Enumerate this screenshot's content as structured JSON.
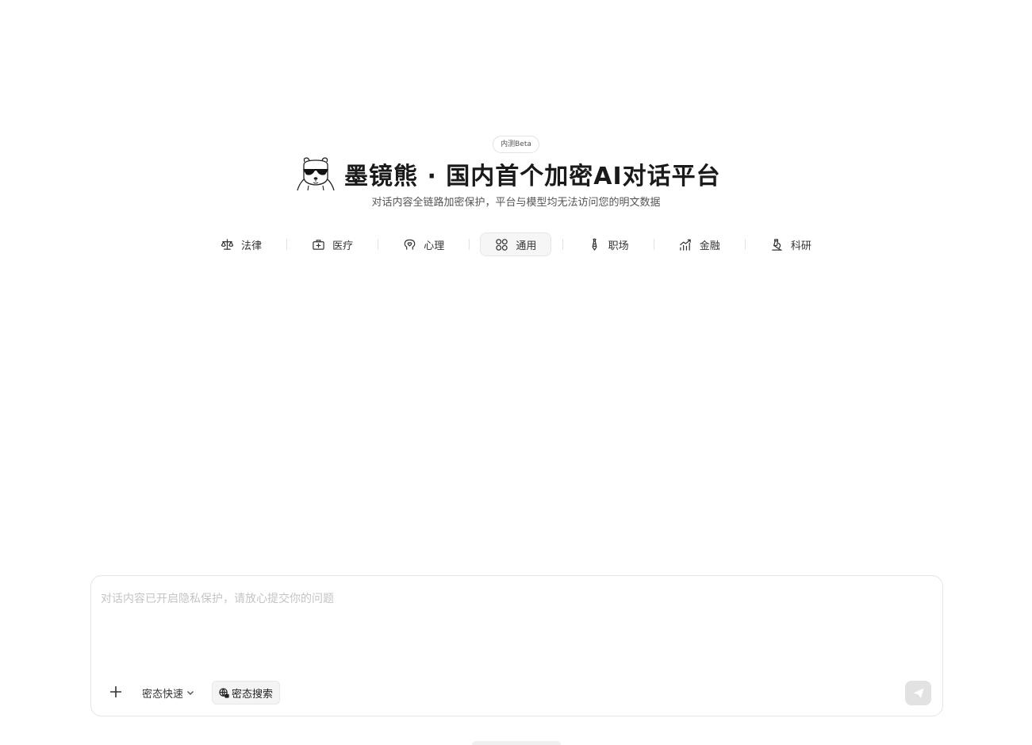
{
  "hero": {
    "badge": "内测Beta",
    "title": "墨镜熊 · 国内首个加密AI对话平台",
    "subtitle": "对话内容全链路加密保护，平台与模型均无法访问您的明文数据",
    "logo_icon": "sunglasses-bear-icon"
  },
  "tabs": [
    {
      "label": "法律",
      "icon": "scale-icon",
      "active": false
    },
    {
      "label": "医疗",
      "icon": "medical-kit-icon",
      "active": false
    },
    {
      "label": "心理",
      "icon": "brain-heart-icon",
      "active": false
    },
    {
      "label": "通用",
      "icon": "grid-circles-icon",
      "active": true
    },
    {
      "label": "职场",
      "icon": "tie-icon",
      "active": false
    },
    {
      "label": "金融",
      "icon": "chart-trend-icon",
      "active": false
    },
    {
      "label": "科研",
      "icon": "microscope-icon",
      "active": false
    }
  ],
  "composer": {
    "placeholder": "对话内容已开启隐私保护，请放心提交你的问题",
    "value": "",
    "mode_label": "密态快速",
    "search_label": "密态搜索"
  },
  "colors": {
    "background": "#ffffff",
    "active_tab_bg": "#f6f6f6",
    "send_disabled": "#e2e2e2",
    "placeholder": "#c4c4c4"
  }
}
